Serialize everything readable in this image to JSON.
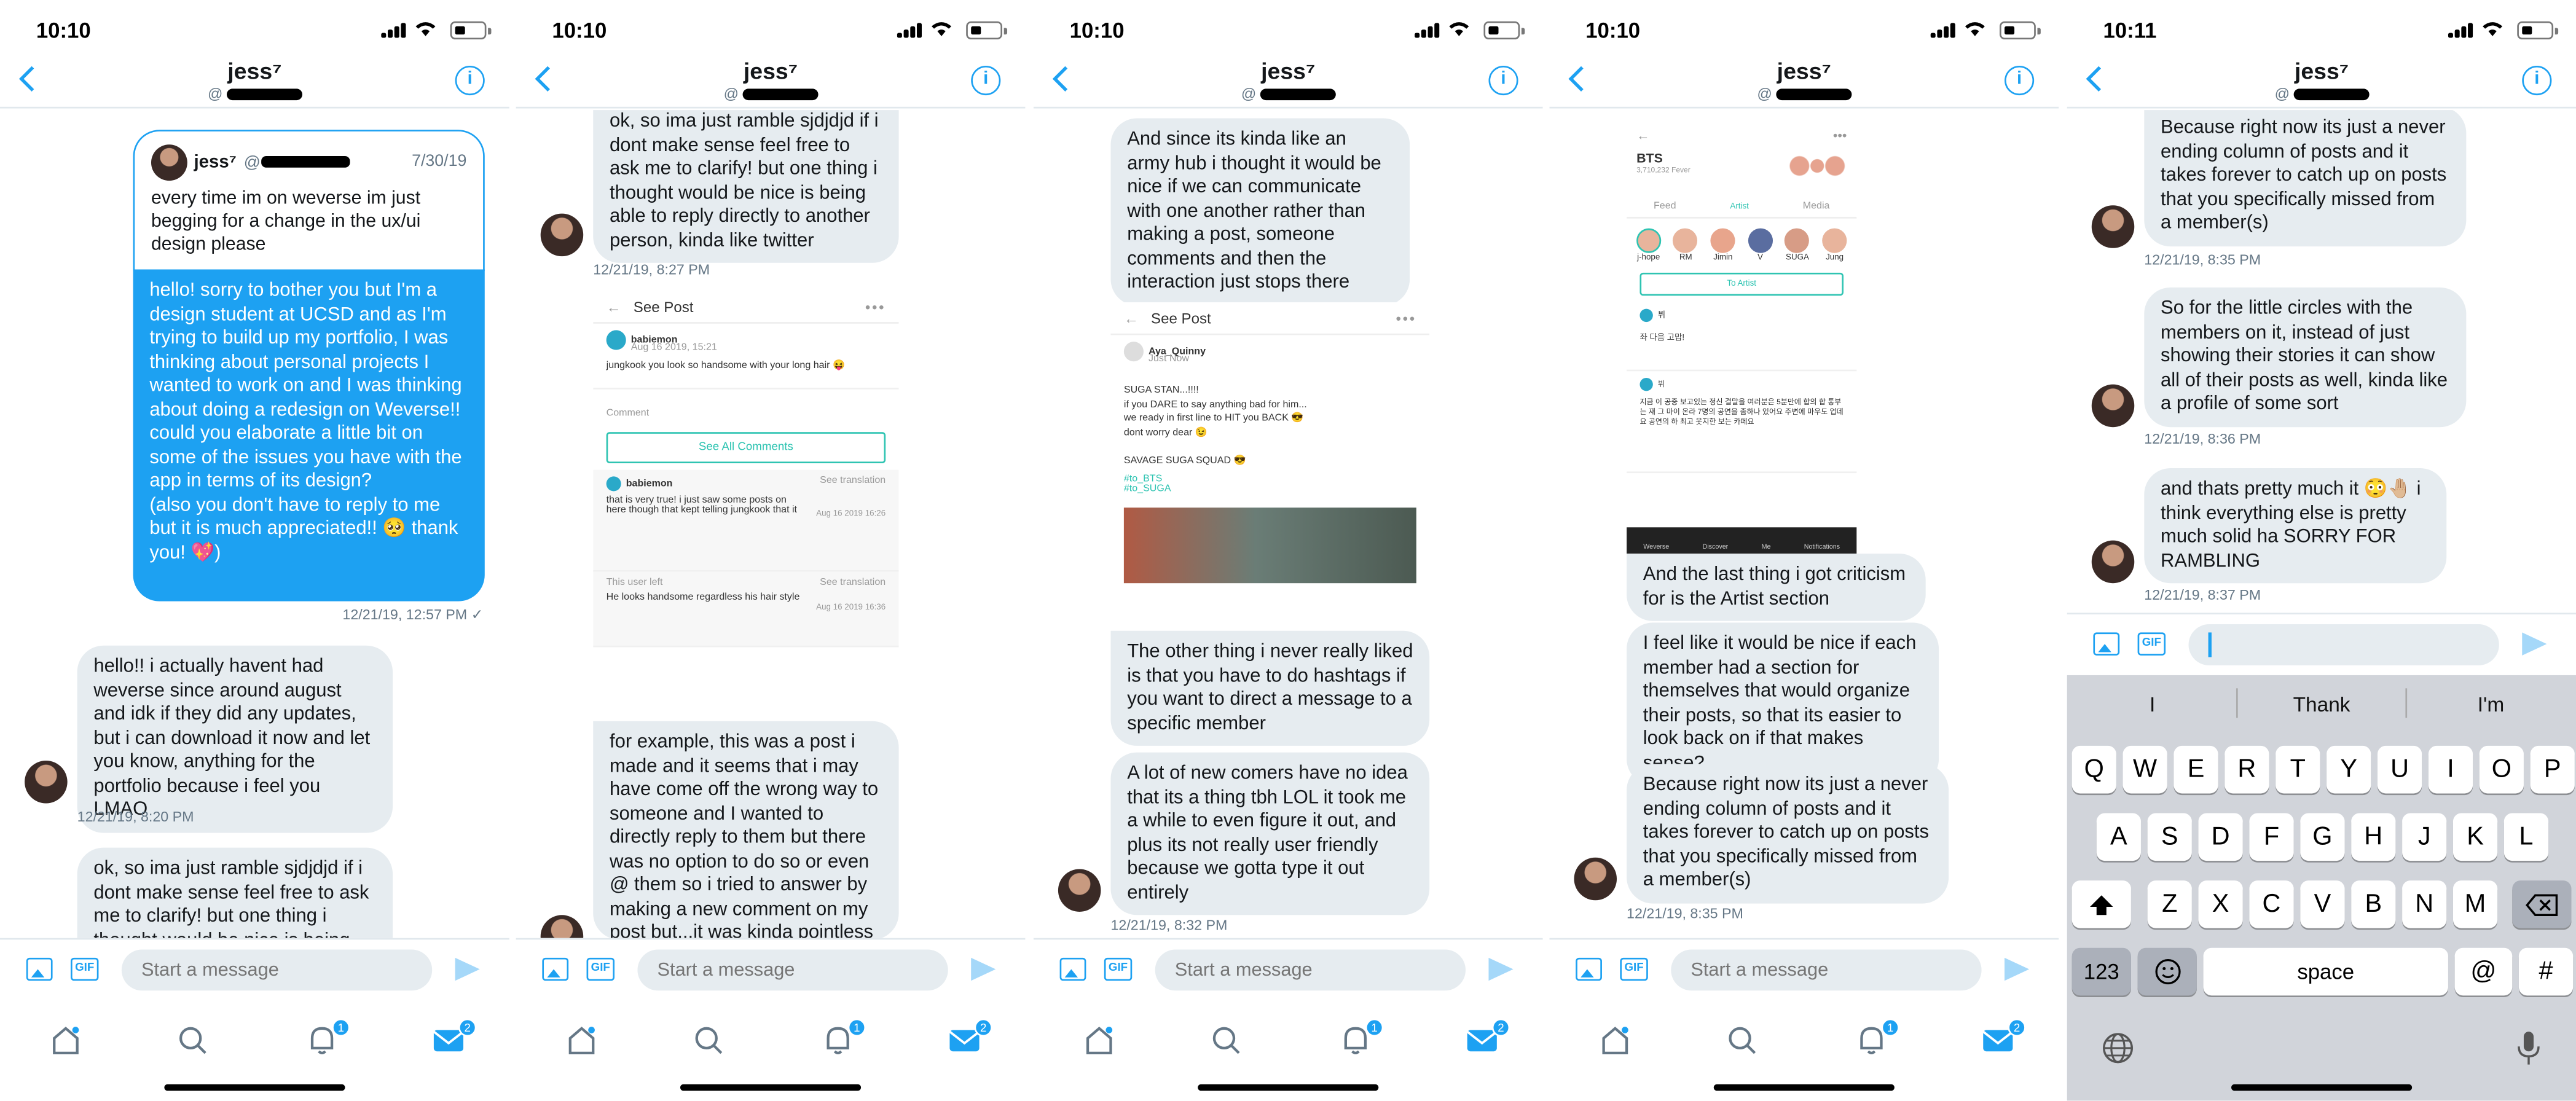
{
  "status": {
    "times": [
      "10:10",
      "10:10",
      "10:10",
      "10:10",
      "10:11"
    ]
  },
  "header": {
    "name": "jess⁷",
    "handle_prefix": "@"
  },
  "compose": {
    "placeholder": "Start a message",
    "gif": "GIF"
  },
  "tabs": {
    "notifications_badge": "1",
    "messages_badge": "2"
  },
  "screen1": {
    "tweet": {
      "name": "jess⁷",
      "handle": "@",
      "date": "7/30/19",
      "text": "every time im on weverse im just begging for a change in the ux/ui design please"
    },
    "my_msg": "hello! sorry to bother you but I'm a design student at UCSD and as I'm trying to build up my portfolio, I was thinking about personal projects I wanted to work on and I was thinking about doing a redesign on Weverse!! could you elaborate a little bit on some of the issues you have with the app in terms of its design?\n(also you don't have to reply to me but it is much appreciated!! 🥺 thank you! 💖)",
    "my_ts": "12/21/19, 12:57 PM ✓",
    "reply1": "hello!! i actually havent had weverse since around august and idk if they did any updates, but i can download it now and let you know, anything for the portfolio because i feel you LMAO",
    "reply1_ts": "12/21/19, 8:20 PM",
    "reply2": "ok, so ima just ramble sjdjdjd if i dont make sense feel free to ask me to clarify! but one thing i thought would be nice is being"
  },
  "screen2": {
    "msg1": "ok, so ima just ramble sjdjdjd if i dont make sense feel free to ask me to clarify! but one thing i thought would be nice is being able to reply directly to another person, kinda like twitter",
    "msg1_ts": "12/21/19, 8:27 PM",
    "card": {
      "title": "See Post",
      "user": "babiemon",
      "date": "Aug 16 2019, 15:21",
      "post": "jungkook you look so handsome with your long hair 😝",
      "comment_label": "Comment",
      "see_all": "See All Comments",
      "c1_user": "babiemon",
      "c1_text": "that is very true! i just saw some posts on here though that kept telling jungkook that it",
      "c1_btn": "See translation",
      "c1_date": "Aug 16 2019 16:26",
      "c2_user": "This user left",
      "c2_text": "He looks handsome regardless his hair style",
      "c2_btn": "See translation",
      "c2_date": "Aug 16 2019 16:36"
    },
    "msg2": "for example, this was a post i made and it seems that i may have come off the wrong way to someone and I wanted to directly reply to them but there was no option to do so or even @ them so i tried to answer by making a new comment on my post but,,,it was kinda pointless LOL"
  },
  "screen3": {
    "msg1": "And since its kinda like an army hub i thought it would be nice if we can communicate with one another rather than making a post, someone comments and then the interaction just stops there",
    "card": {
      "title": "See Post",
      "user": "Aya_Quinny",
      "time": "Just Now",
      "text": "SUGA STAN...!!!!\nif you DARE to say anything bad for him...\nwe ready in first line to HIT you BACK 😎\ndont worry dear 😉\n\nSAVAGE SUGA SQUAD 😎",
      "tag1": "#to_BTS",
      "tag2": "#to_SUGA"
    },
    "msg2": "The other thing i never really liked is that you have to do hashtags if you want to direct a message to a specific member",
    "msg3": "A lot of new comers have no idea that its a thing tbh LOL it took me a while to even figure it out, and plus its not really user friendly because we gotta type it out entirely",
    "msg3_ts": "12/21/19, 8:32 PM"
  },
  "screen4": {
    "card": {
      "artist": "BTS",
      "followers": "3,710,232 Fever",
      "tab_feed": "Feed",
      "tab_artist": "Artist",
      "tab_media": "Media",
      "members": [
        "j-hope",
        "RM",
        "Jimin",
        "V",
        "SUGA",
        "Jung"
      ],
      "to_artist": "To Artist",
      "p1_user": "뷔",
      "p1_text": "좌 다음 고맙!",
      "p2_user": "뷔",
      "p2_text": "지금 이 공중 보고있는 정신 결말을 여러분은 5분만에 합의 합 통부는 재 그 마이 온라 7명의 공연을 좀하나 있어요 주변에 마우도 업데요 공연의 하 최고 웃지한 보는 카페요",
      "nav": [
        "Weverse",
        "Discover",
        "Me",
        "Notifications"
      ]
    },
    "msg1": "And the last thing i got criticism for is the Artist section",
    "msg2": "I feel like it would be nice if each member had a section for themselves that would organize their posts, so that its easier to look back on if that makes sense?",
    "msg3": "Because right now its just a never ending column of posts and it takes forever to catch up on posts that you specifically missed from a member(s)",
    "msg3_ts": "12/21/19, 8:35 PM"
  },
  "screen5": {
    "msg1": "Because right now its just a never ending column of posts and it takes forever to catch up on posts that you specifically missed from a member(s)",
    "msg1_ts": "12/21/19, 8:35 PM",
    "msg2": "So for the little circles with the members on it, instead of just showing their stories it can show all of their posts as well, kinda like a profile of some sort",
    "msg2_ts": "12/21/19, 8:36 PM",
    "msg3": "and thats pretty much it 😳🤚🏼 i think everything else is pretty much solid ha SORRY FOR RAMBLING",
    "msg3_ts": "12/21/19, 8:37 PM",
    "suggestions": [
      "I",
      "Thank",
      "I'm"
    ],
    "row1": [
      "Q",
      "W",
      "E",
      "R",
      "T",
      "Y",
      "U",
      "I",
      "O",
      "P"
    ],
    "row2": [
      "A",
      "S",
      "D",
      "F",
      "G",
      "H",
      "J",
      "K",
      "L"
    ],
    "row3": [
      "Z",
      "X",
      "C",
      "V",
      "B",
      "N",
      "M"
    ],
    "k123": "123",
    "space": "space",
    "at": "@",
    "hash": "#"
  }
}
